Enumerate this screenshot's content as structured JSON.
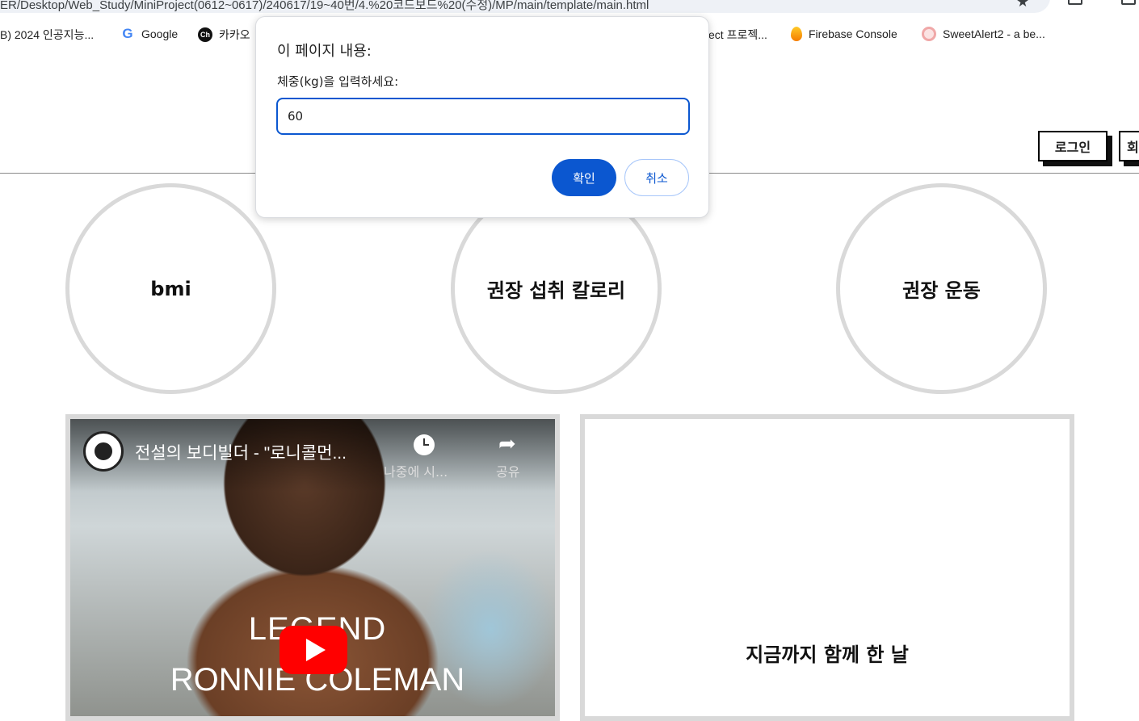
{
  "browser": {
    "url": "ER/Desktop/Web_Study/MiniProject(0612~0617)/240617/19~40번/4.%20코드보드%20(수정)/MP/main/template/main.html",
    "bookmarks": [
      {
        "label": "B) 2024 인공지능...",
        "icon": "none"
      },
      {
        "label": "Google",
        "icon": "google-icon"
      },
      {
        "label": "카카오",
        "icon": "channel-icon"
      },
      {
        "label": "ect 프로젝...",
        "icon": "none"
      },
      {
        "label": "Firebase Console",
        "icon": "firebase-icon"
      },
      {
        "label": "SweetAlert2 - a be...",
        "icon": "sweetalert-icon"
      }
    ]
  },
  "header": {
    "login_label": "로그인",
    "signup_label": "회"
  },
  "menu": {
    "circles": [
      {
        "label": "bmi"
      },
      {
        "label": "권장 섭취 칼로리"
      },
      {
        "label": "권장 운동"
      }
    ]
  },
  "video": {
    "title": "전설의 보디빌더 - \"로니콜먼...",
    "watch_later": "나중에 시...",
    "share": "공유",
    "overlay_line1": "LEGEND",
    "overlay_line2": "RONNIE COLEMAN"
  },
  "days_panel": {
    "label": "지금까지 함께 한 날"
  },
  "dialog": {
    "title": "이 페이지 내용:",
    "message": "체중(kg)을 입력하세요:",
    "input_value": "60",
    "ok_label": "확인",
    "cancel_label": "취소",
    "accent_color": "#0b57d0"
  }
}
